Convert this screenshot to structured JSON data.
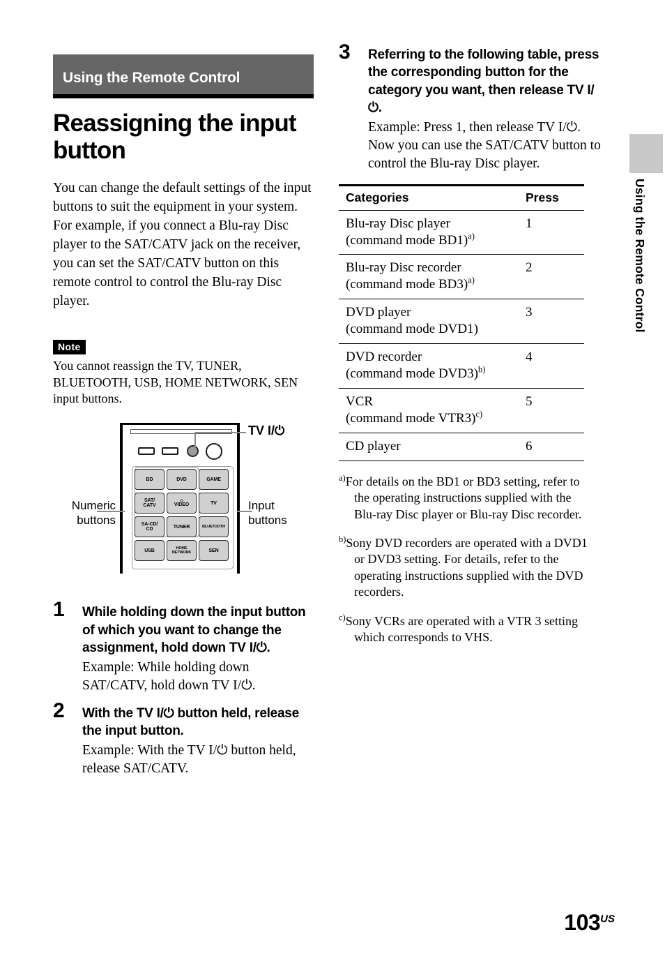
{
  "section": {
    "header": "Using the Remote Control"
  },
  "title": "Reassigning the input button",
  "intro": "You can change the default settings of the input buttons to suit the equipment in your system. For example, if you connect a Blu-ray Disc player to the SAT/CATV jack on the receiver, you can set the SAT/CATV button on this remote control to control the Blu-ray Disc player.",
  "note": {
    "badge": "Note",
    "text": "You cannot reassign the TV, TUNER, BLUETOOTH, USB, HOME NETWORK, SEN input buttons."
  },
  "figure": {
    "label_tv_power": "TV I/⏻",
    "label_numeric": "Numeric buttons",
    "label_input": "Input buttons",
    "buttons": [
      "BD",
      "DVD",
      "GAME",
      "SAT/ CATV",
      "VIDEO",
      "TV",
      "SA-CD/ CD",
      "TUNER",
      "BLUETOOTH",
      "USB",
      "HOME NETWORK",
      "SEN"
    ],
    "button_rows": [
      [
        "BD",
        "DVD",
        "GAME"
      ],
      [
        "SAT/\nCATV",
        "VIDEO",
        "TV"
      ],
      [
        "SA-CD/\nCD",
        "TUNER",
        "BLUETOOTH"
      ],
      [
        "USB",
        "HOME\nNETWORK",
        "SEN"
      ]
    ]
  },
  "steps": [
    {
      "num": "1",
      "head": "While holding down the input button of which you want to change the assignment, hold down TV I/⏻.",
      "body": "Example: While holding down SAT/CATV, hold down TV I/⏻."
    },
    {
      "num": "2",
      "head": "With the TV I/⏻ button held, release the input button.",
      "body": "Example: With the TV I/⏻ button held, release SAT/CATV."
    },
    {
      "num": "3",
      "head": "Referring to the following table, press the corresponding button for the category you want, then release TV I/⏻.",
      "body": "Example: Press 1, then release TV I/⏻. Now you can use the SAT/CATV button to control the Blu-ray Disc player."
    }
  ],
  "table": {
    "headers": {
      "categories": "Categories",
      "press": "Press"
    },
    "rows": [
      {
        "category": "Blu-ray Disc player (command mode BD1)",
        "footnote": "a)",
        "press": "1"
      },
      {
        "category": "Blu-ray Disc recorder (command mode BD3)",
        "footnote": "a)",
        "press": "2"
      },
      {
        "category": "DVD player (command mode DVD1)",
        "footnote": "",
        "press": "3"
      },
      {
        "category": "DVD recorder (command mode DVD3)",
        "footnote": "b)",
        "press": "4"
      },
      {
        "category": "VCR (command mode VTR3)",
        "footnote": "c)",
        "press": "5"
      },
      {
        "category": "CD player",
        "footnote": "",
        "press": "6"
      }
    ]
  },
  "footnotes": [
    {
      "mark": "a)",
      "text": "For details on the BD1 or BD3 setting, refer to the operating instructions supplied with the Blu-ray Disc player or Blu-ray Disc recorder."
    },
    {
      "mark": "b)",
      "text": "Sony DVD recorders are operated with a DVD1 or DVD3 setting. For details, refer to the operating instructions supplied with the DVD recorders."
    },
    {
      "mark": "c)",
      "text": "Sony VCRs are operated with a VTR 3 setting which corresponds to VHS."
    }
  ],
  "side_tab": {
    "text": "Using the Remote Control"
  },
  "page": {
    "number": "103",
    "region": "US"
  }
}
